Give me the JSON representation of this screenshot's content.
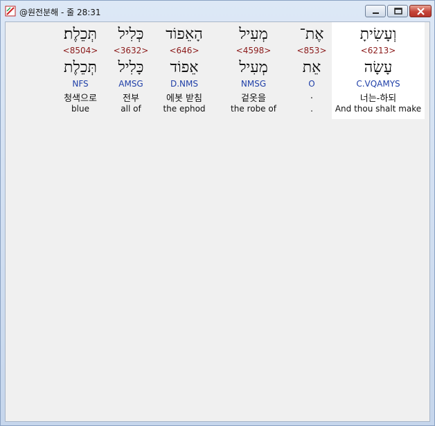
{
  "window": {
    "title": "@원전분해 - 줄 28:31"
  },
  "words": [
    {
      "hebrew": "וְעָשִׂיתָ",
      "strong": "<6213>",
      "lemma": "עָשָׂה",
      "parse": "C.VQAMYS",
      "korean": "너는-하되",
      "english": "And thou shalt make"
    },
    {
      "hebrew": "אֶת־",
      "strong": "<853>",
      "lemma": "אֵת",
      "parse": "O",
      "korean": ".",
      "english": "."
    },
    {
      "hebrew": "מְעִיל",
      "strong": "<4598>",
      "lemma": "מְעִיל",
      "parse": "NMSG",
      "korean": "겉옷을",
      "english": "the robe of"
    },
    {
      "hebrew": "הָאֵפוֹד",
      "strong": "<646>",
      "lemma": "אֵפוֹד",
      "parse": "D.NMS",
      "korean": "에봇 받침",
      "english": "the ephod"
    },
    {
      "hebrew": "כְּלִיל",
      "strong": "<3632>",
      "lemma": "כָּלִיל",
      "parse": "AMSG",
      "korean": "전부",
      "english": "all of"
    },
    {
      "hebrew": "תְּכֵלֶת׃",
      "strong": "<8504>",
      "lemma": "תְּכֵלֶת",
      "parse": "NFS",
      "korean": "청색으로",
      "english": "blue"
    }
  ]
}
